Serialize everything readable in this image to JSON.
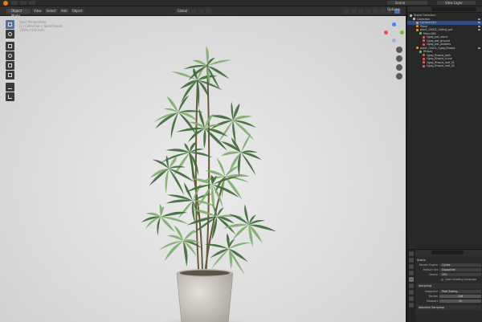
{
  "topbar": {
    "scene_label": "Scene",
    "view_layer_label": "View Layer"
  },
  "viewport_header": {
    "mode": "Object Mode",
    "menus": [
      "View",
      "Select",
      "Add",
      "Object"
    ],
    "orientation": "Global",
    "options": "Options"
  },
  "viewport": {
    "overlay_lines": [
      "User Perspective",
      "(1) Collection | Sketchbook",
      "100% / 0.0 mm"
    ]
  },
  "outliner": {
    "rows": [
      {
        "label": "Scene Collection",
        "depth": 0,
        "icon": "collection-icon",
        "color": "#bbbbbb",
        "selected": false
      },
      {
        "label": "Collection",
        "depth": 1,
        "icon": "collection-icon",
        "color": "#bbbbbb",
        "selected": false
      },
      {
        "label": "Camera.001",
        "depth": 2,
        "icon": "camera-icon",
        "color": "#d99a55",
        "selected": true
      },
      {
        "label": "Plane",
        "depth": 2,
        "icon": "mesh-icon",
        "color": "#e08a3a",
        "selected": false
      },
      {
        "label": "plant_13001_Ceiling_pot",
        "depth": 2,
        "icon": "object-icon",
        "color": "#e08a3a",
        "selected": false
      },
      {
        "label": "Mesh.001",
        "depth": 3,
        "icon": "mesh-data-icon",
        "color": "#6fb06a",
        "selected": false
      },
      {
        "label": "Cgag_pot_stone",
        "depth": 4,
        "icon": "material-icon",
        "color": "#d65a5a",
        "selected": false
      },
      {
        "label": "Cgag_pot_ground",
        "depth": 4,
        "icon": "material-icon",
        "color": "#d65a5a",
        "selected": false
      },
      {
        "label": "Cgag_pot_pebbles",
        "depth": 4,
        "icon": "material-icon",
        "color": "#d65a5a",
        "selected": false
      },
      {
        "label": "plant_13001_Cgag_Rhapis",
        "depth": 2,
        "icon": "object-icon",
        "color": "#e08a3a",
        "selected": false
      },
      {
        "label": "Rhapis",
        "depth": 3,
        "icon": "mesh-data-icon",
        "color": "#6fb06a",
        "selected": false
      },
      {
        "label": "Cgag_Rhapis_bark",
        "depth": 4,
        "icon": "material-icon",
        "color": "#d65a5a",
        "selected": false
      },
      {
        "label": "Cgag_Rhapis_trunk",
        "depth": 4,
        "icon": "material-icon",
        "color": "#d65a5a",
        "selected": false
      },
      {
        "label": "Cgag_Rhapis_leaf_01",
        "depth": 4,
        "icon": "material-icon",
        "color": "#d65a5a",
        "selected": false
      },
      {
        "label": "Cgag_Rhapis_leaf_02",
        "depth": 4,
        "icon": "material-icon",
        "color": "#d65a5a",
        "selected": false
      }
    ]
  },
  "properties": {
    "title": "Scene",
    "render_engine_label": "Render Engine",
    "render_engine_value": "Cycles",
    "feature_set_label": "Feature Set",
    "feature_set_value": "Supported",
    "device_label": "Device",
    "device_value": "CPU",
    "osl_label": "Open Shading Language",
    "sampling_header": "Sampling",
    "integrator_label": "Integrator",
    "integrator_value": "Path Tracing",
    "render_label": "Render",
    "render_value": "128",
    "viewport_label": "Viewport",
    "viewport_value": "32",
    "adaptive_label": "Adaptive Sampling"
  },
  "colors": {
    "accent": "#4772b3",
    "leaf_dark": "#3f6b3a",
    "leaf_light": "#7fae6d",
    "pot": "#cfcac2"
  }
}
